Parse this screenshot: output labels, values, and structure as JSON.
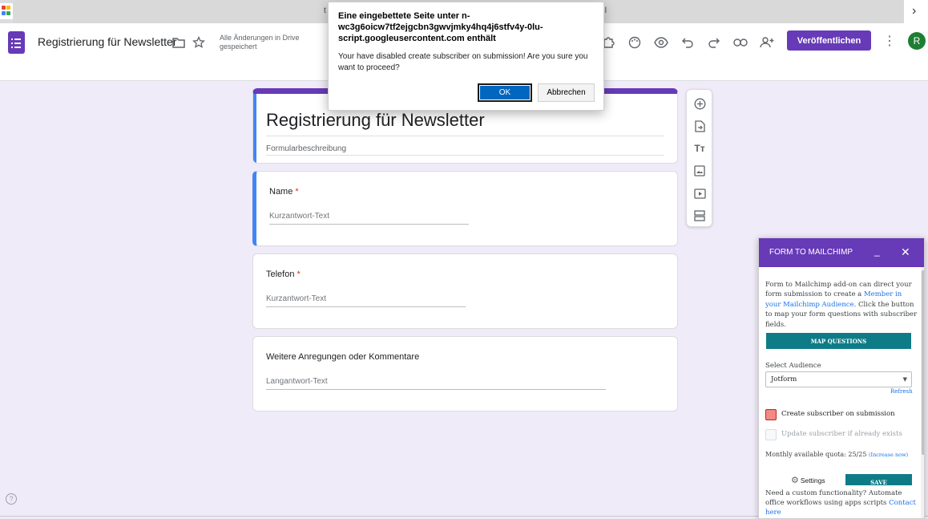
{
  "tabstrip": {
    "fragment_left": "t",
    "fragment_right": "ıl",
    "chevron": "›"
  },
  "header": {
    "title": "Registrierung für Newsletter",
    "save_status": "Alle Änderungen in Drive gespeichert",
    "publish_label": "Veröffentlichen",
    "avatar_initial": "R",
    "icons": [
      "folder-icon",
      "star-icon",
      "addon-icon",
      "palette-icon",
      "preview-eye-icon",
      "undo-icon",
      "redo-icon",
      "link-icon",
      "add-collaborator-icon",
      "more-vert-icon"
    ]
  },
  "form": {
    "title": "Registrierung für Newsletter",
    "description_placeholder": "Formularbeschreibung",
    "questions": [
      {
        "label": "Name",
        "required_mark": "*",
        "hint": "Kurzantwort-Text"
      },
      {
        "label": "Telefon",
        "required_mark": "*",
        "hint": "Kurzantwort-Text"
      },
      {
        "label": "Weitere Anregungen oder Kommentare",
        "required_mark": "",
        "hint": "Langantwort-Text"
      }
    ]
  },
  "toolbar": {
    "icons": [
      "add-question-icon",
      "import-questions-icon",
      "add-title-icon",
      "add-image-icon",
      "add-video-icon",
      "add-section-icon"
    ]
  },
  "dialog": {
    "title": "Eine eingebettete Seite unter n-wc3g6oicw7tf2ejgcbn3gwvjmky4hq4j6stfv4y-0lu-script.googleusercontent.com enthält",
    "message": "Your have disabled create subscriber on submission! Are you sure you want to proceed?",
    "ok_label": "OK",
    "cancel_label": "Abbrechen"
  },
  "mailchimp": {
    "title": "FORM TO MAILCHIMP",
    "minimize": "_",
    "close": "✕",
    "intro_1": "Form to Mailchimp add-on can direct your form submission to create a ",
    "intro_link": "Member in your Mailchimp Audience",
    "intro_2": ". Click the button to map your form questions with subscriber fields.",
    "map_button": "MAP QUESTIONS",
    "audience_label": "Select Audience",
    "audience_value": "Jotform",
    "refresh": "Refresh",
    "create_label": "Create subscriber on submission",
    "update_label": "Update subscriber if already exists",
    "quota": "Monthly available quota: 25/25 ",
    "quota_link": "(Increase now)",
    "settings_label": "Settings",
    "save_label": "SAVE",
    "footer_text": "Need a custom functionality? Automate office workflows using apps scripts ",
    "footer_link": "Contact here"
  },
  "colors": {
    "brand": "#673ab7",
    "accent_blue": "#4285f4",
    "teal": "#0e7c86",
    "required": "#d93025"
  }
}
